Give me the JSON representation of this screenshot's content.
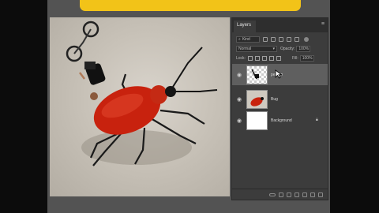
{
  "banner": {
    "color": "#f2c318"
  },
  "panel": {
    "tab_label": "Layers",
    "menu_icon": "hamburger-icon",
    "filter": {
      "kind_label": "Kind"
    },
    "blend": {
      "mode": "Normal",
      "opacity_label": "Opacity:",
      "opacity_value": "100%"
    },
    "lock": {
      "label": "Lock:",
      "fill_label": "Fill:",
      "fill_value": "100%"
    },
    "layers": [
      {
        "name": "person",
        "visible": true,
        "selected": true,
        "thumb": "transparent"
      },
      {
        "name": "Bug",
        "visible": true,
        "selected": false,
        "thumb": "bug"
      },
      {
        "name": "Background",
        "visible": true,
        "selected": false,
        "thumb": "white",
        "locked": true
      }
    ]
  }
}
